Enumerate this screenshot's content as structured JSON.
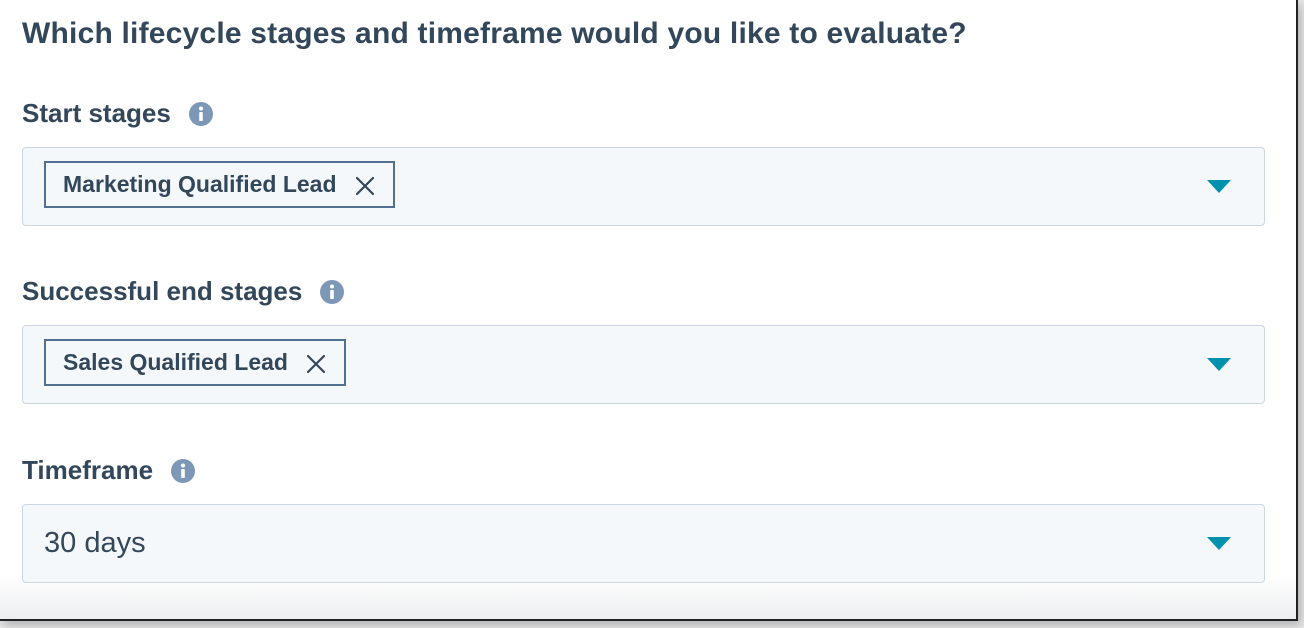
{
  "heading": "Which lifecycle stages and timeframe would you like to evaluate?",
  "fields": {
    "start_stages": {
      "label": "Start stages",
      "tags": [
        "Marketing Qualified Lead"
      ]
    },
    "end_stages": {
      "label": "Successful end stages",
      "tags": [
        "Sales Qualified Lead"
      ]
    },
    "timeframe": {
      "label": "Timeframe",
      "value": "30 days"
    }
  },
  "icons": {
    "info": "info-icon",
    "remove": "close-icon",
    "dropdown": "caret-down-icon"
  },
  "colors": {
    "text": "#33475b",
    "info_icon": "#7c98b6",
    "caret": "#0091ae",
    "field_bg": "#f5f8fa",
    "field_border": "#cbd6e2",
    "tag_border": "#516f90"
  }
}
